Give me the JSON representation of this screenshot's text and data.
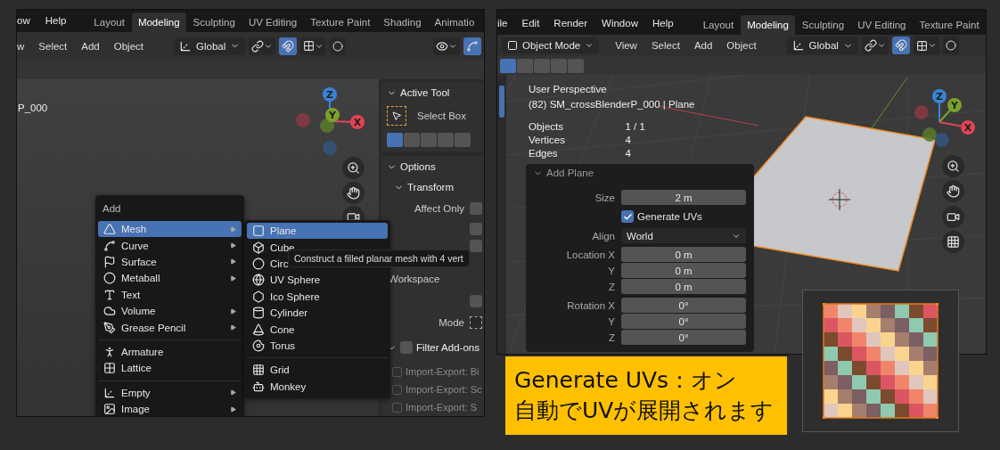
{
  "left": {
    "menu_bar": [
      "ow",
      "Help"
    ],
    "workspace_tabs": [
      {
        "label": "Layout",
        "selected": false
      },
      {
        "label": "Modeling",
        "selected": true
      },
      {
        "label": "Sculpting",
        "selected": false
      },
      {
        "label": "UV Editing",
        "selected": false
      },
      {
        "label": "Texture Paint",
        "selected": false
      },
      {
        "label": "Shading",
        "selected": false
      },
      {
        "label": "Animatio",
        "selected": false
      }
    ],
    "header_menu": [
      "w",
      "Select",
      "Add",
      "Object"
    ],
    "orientation": "Global",
    "object_label": "P_000",
    "gizmo": {
      "z": "Z",
      "y": "Y",
      "x": "X"
    },
    "sidebar": {
      "active_tool_title": "Active Tool",
      "tool": "Select Box",
      "options_title": "Options",
      "transform_title": "Transform",
      "affect_only": {
        "label": "Affect Only",
        "checked": false
      },
      "option_checks": [
        {
          "checked": false
        },
        {
          "checked": false
        }
      ],
      "workspace": "Workspace",
      "workspace_check": {
        "checked": false
      },
      "mode": "Mode",
      "filter": {
        "label": "Filter Add-ons",
        "checked": false
      },
      "addons": [
        {
          "label": "Import-Export: Bi",
          "checked": false
        },
        {
          "label": "Import-Export: Sc",
          "checked": false
        },
        {
          "label": "Import-Export: S",
          "checked": false
        }
      ]
    },
    "add_menu": {
      "title": "Add",
      "groups": [
        [
          {
            "label": "Mesh",
            "submenu": true,
            "selected": true
          },
          {
            "label": "Curve",
            "submenu": true,
            "selected": false
          },
          {
            "label": "Surface",
            "submenu": true,
            "selected": false
          },
          {
            "label": "Metaball",
            "submenu": true,
            "selected": false
          },
          {
            "label": "Text",
            "submenu": false,
            "selected": false
          },
          {
            "label": "Volume",
            "submenu": true,
            "selected": false
          },
          {
            "label": "Grease Pencil",
            "submenu": true,
            "selected": false
          }
        ],
        [
          {
            "label": "Armature",
            "submenu": false,
            "selected": false
          },
          {
            "label": "Lattice",
            "submenu": false,
            "selected": false
          }
        ],
        [
          {
            "label": "Empty",
            "submenu": true,
            "selected": false
          },
          {
            "label": "Image",
            "submenu": true,
            "selected": false
          }
        ]
      ]
    },
    "mesh_menu": {
      "groups": [
        [
          {
            "label": "Plane",
            "selected": true
          },
          {
            "label": "Cube",
            "selected": false
          },
          {
            "label": "Circ",
            "selected": false
          },
          {
            "label": "UV Sphere",
            "selected": false
          },
          {
            "label": "Ico Sphere",
            "selected": false
          },
          {
            "label": "Cylinder",
            "selected": false
          },
          {
            "label": "Cone",
            "selected": false
          },
          {
            "label": "Torus",
            "selected": false
          }
        ],
        [
          {
            "label": "Grid",
            "selected": false
          },
          {
            "label": "Monkey",
            "selected": false
          }
        ]
      ]
    },
    "tooltip": "Construct a filled planar mesh with 4 vert"
  },
  "right": {
    "menu_bar": [
      "ile",
      "Edit",
      "Render",
      "Window",
      "Help"
    ],
    "workspace_tabs": [
      {
        "label": "Layout",
        "selected": false
      },
      {
        "label": "Modeling",
        "selected": true
      },
      {
        "label": "Sculpting",
        "selected": false
      },
      {
        "label": "UV Editing",
        "selected": false
      },
      {
        "label": "Texture Paint",
        "selected": false
      }
    ],
    "mode": "Object Mode",
    "header_menu": [
      "View",
      "Select",
      "Add",
      "Object"
    ],
    "orientation": "Global",
    "overlay": {
      "view": "User Perspective",
      "object": "(82) SM_crossBlenderP_000 | Plane",
      "stats": [
        {
          "label": "Objects",
          "value": "1 / 1"
        },
        {
          "label": "Vertices",
          "value": "4"
        },
        {
          "label": "Edges",
          "value": "4"
        }
      ]
    },
    "gizmo": {
      "z": "Z",
      "y": "Y",
      "x": "X"
    },
    "redo_panel": {
      "title": "Add Plane",
      "rows": [
        {
          "kind": "number",
          "label": "Size",
          "value": "2 m"
        },
        {
          "kind": "checkbox",
          "label": "Generate UVs",
          "checked": true
        },
        {
          "kind": "dropdown",
          "label": "Align",
          "value": "World"
        },
        {
          "kind": "number",
          "label": "Location X",
          "value": "0 m"
        },
        {
          "kind": "number",
          "label": "Y",
          "value": "0 m"
        },
        {
          "kind": "number",
          "label": "Z",
          "value": "0 m"
        },
        {
          "kind": "number",
          "label": "Rotation X",
          "value": "0°"
        },
        {
          "kind": "number",
          "label": "Y",
          "value": "0°"
        },
        {
          "kind": "number",
          "label": "Z",
          "value": "0°"
        }
      ]
    }
  },
  "caption": [
    "Generate UVs：オン",
    "自動でUVが展開されます"
  ]
}
